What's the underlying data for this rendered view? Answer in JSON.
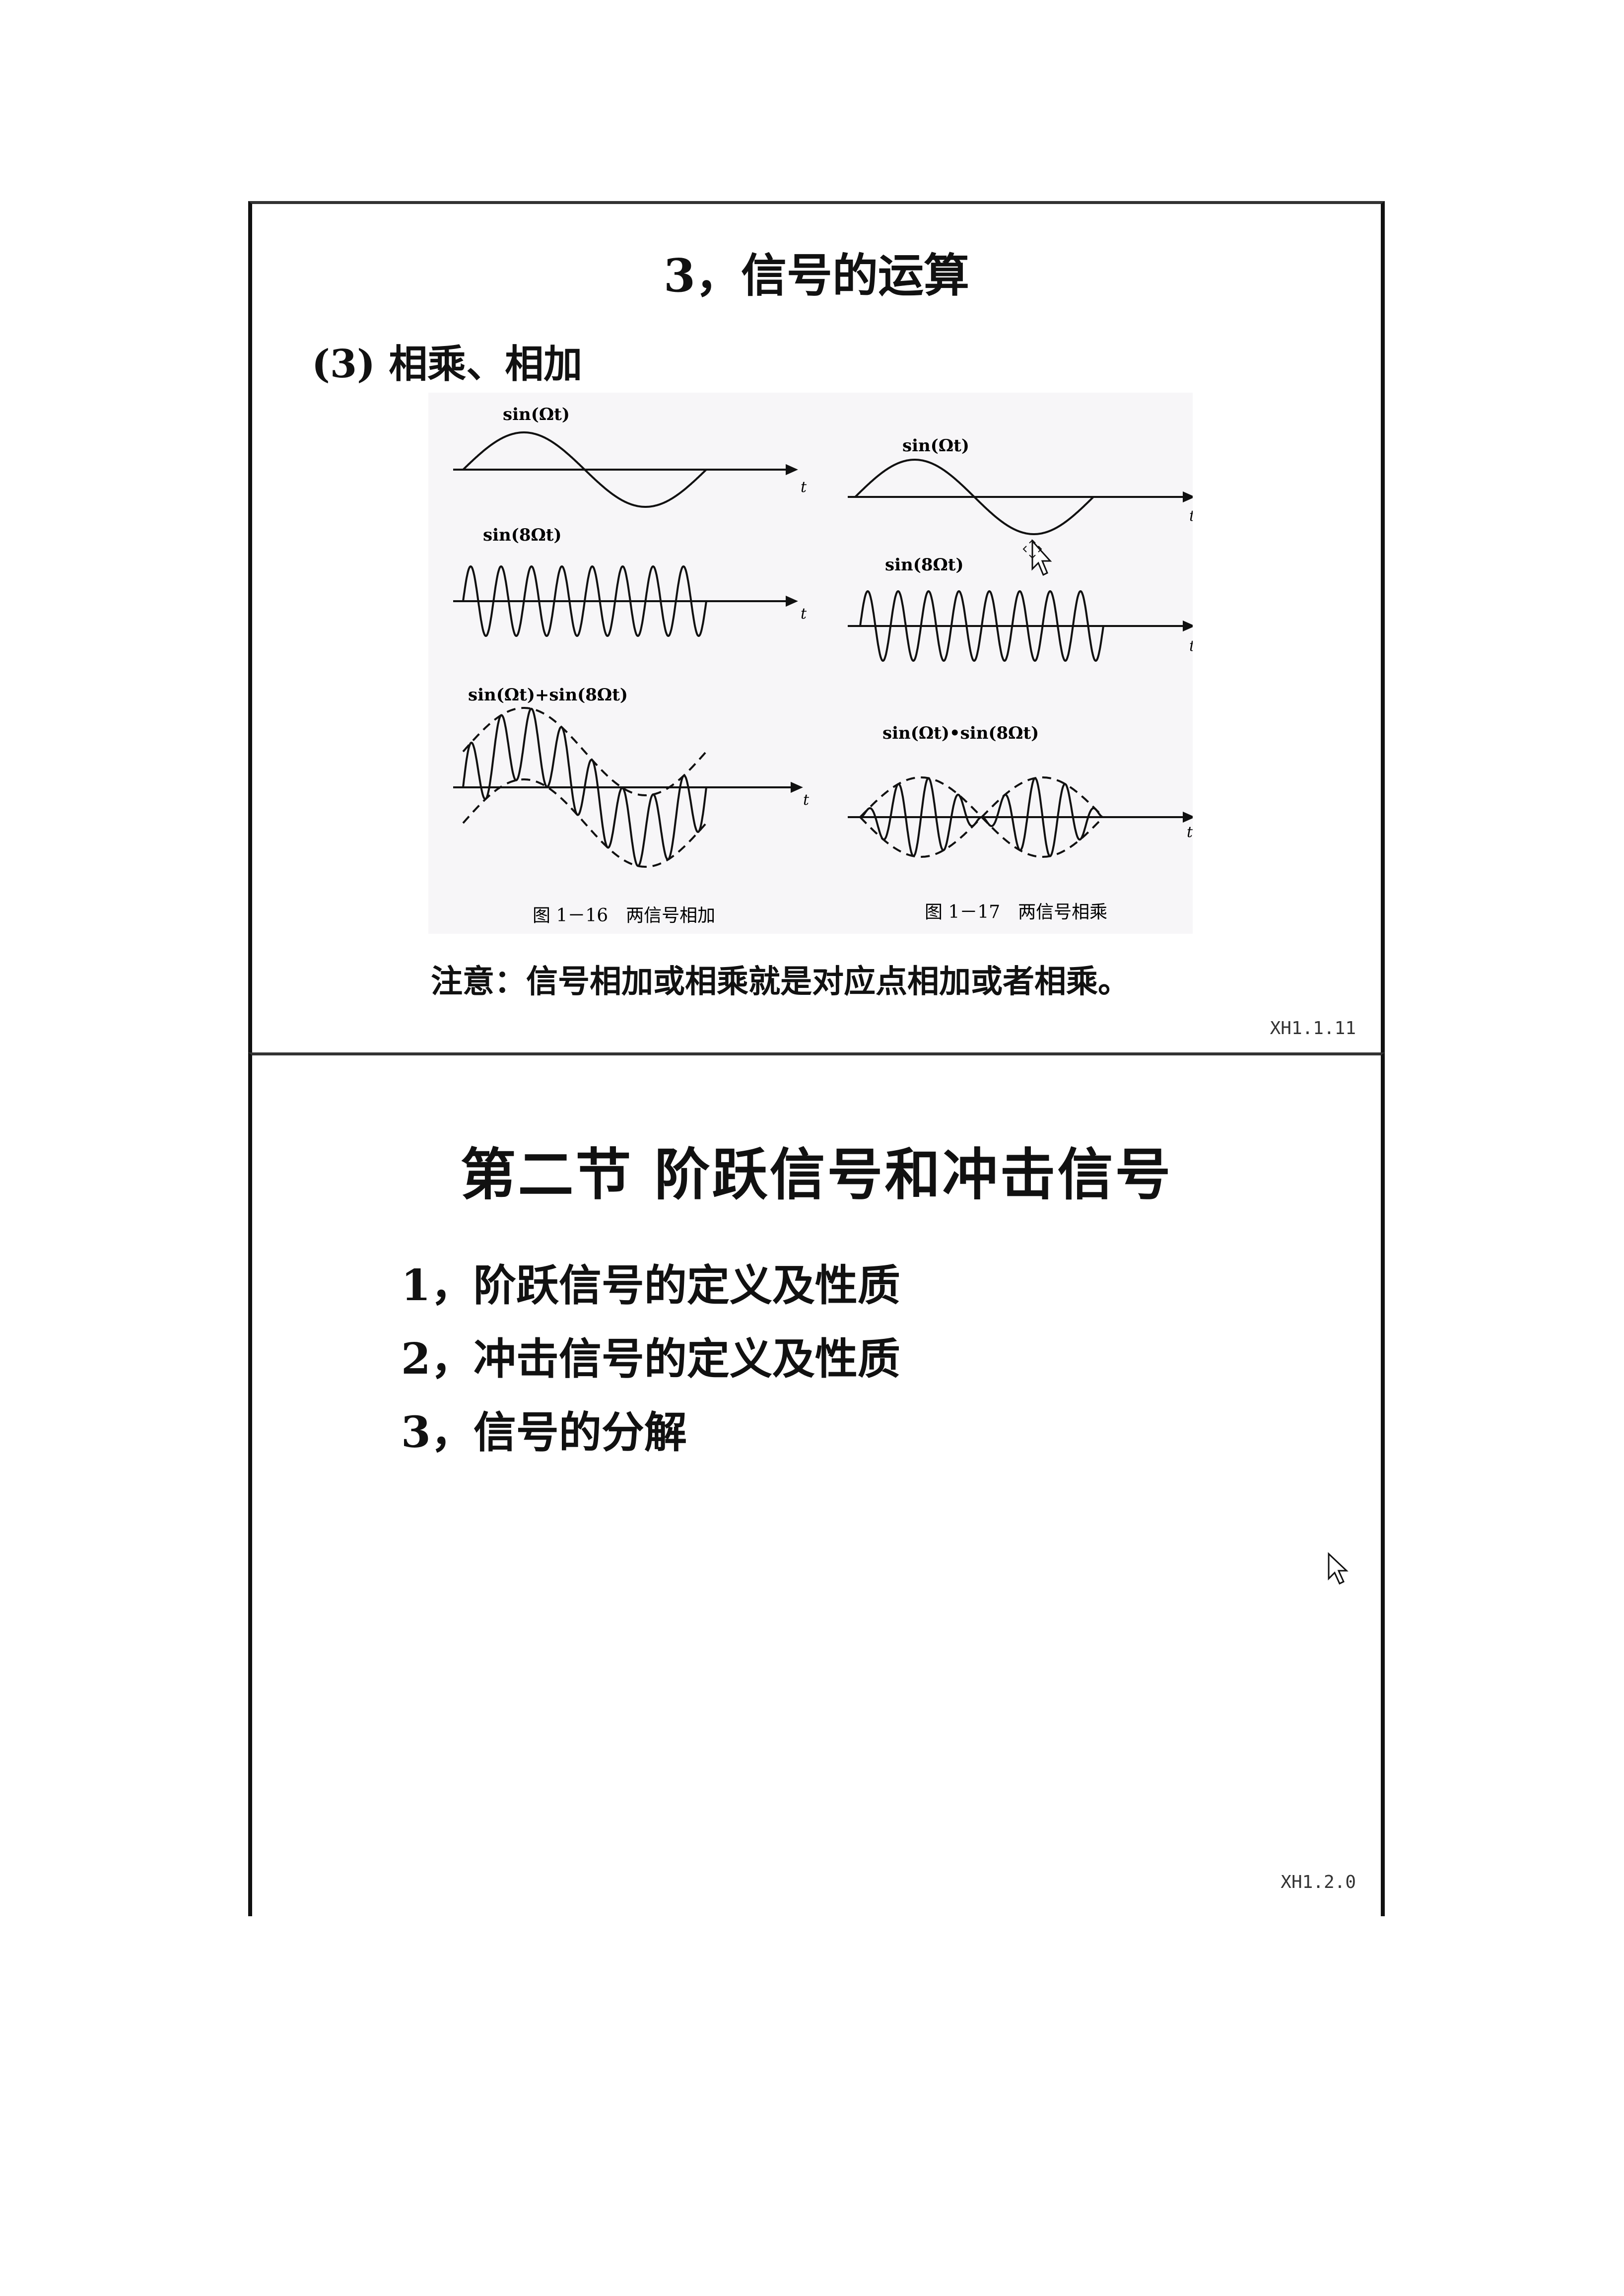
{
  "slide1": {
    "title": "3，信号的运算",
    "subhead": "(3) 相乘、相加",
    "figure_left": {
      "panel1_label": "sin(Ωt)",
      "panel2_label": "sin(8Ωt)",
      "panel3_label": "sin(Ωt)+sin(8Ωt)",
      "axis_label": "t",
      "caption": "图 1－16　两信号相加"
    },
    "figure_right": {
      "panel1_label": "sin(Ωt)",
      "panel2_label": "sin(8Ωt)",
      "panel3_label": "sin(Ωt)•sin(8Ωt)",
      "axis_label": "t",
      "caption": "图 1－17　两信号相乘"
    },
    "note": "注意：信号相加或相乘就是对应点相加或者相乘。",
    "slide_id": "XH1.1.11"
  },
  "slide2": {
    "title": "第二节 阶跃信号和冲击信号",
    "items": [
      "1，阶跃信号的定义及性质",
      "2，冲击信号的定义及性质",
      "3，信号的分解"
    ],
    "slide_id": "XH1.2.0"
  },
  "icons": {
    "move_cursor": "move-cursor-icon",
    "pointer_cursor": "arrow-cursor-icon"
  }
}
